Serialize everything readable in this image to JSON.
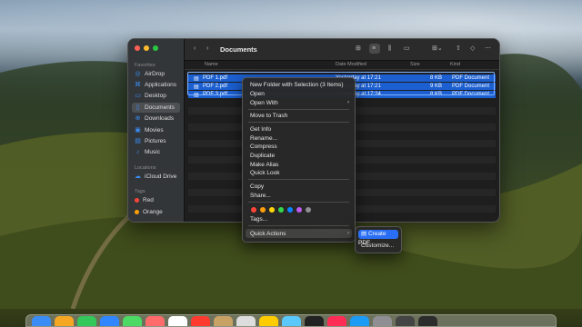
{
  "finder": {
    "title": "Documents",
    "sidebar": {
      "favorites_label": "Favorites",
      "favorites": [
        "AirDrop",
        "Applications",
        "Desktop",
        "Documents",
        "Downloads",
        "Movies",
        "Pictures",
        "Music"
      ],
      "locations_label": "Locations",
      "locations": [
        "iCloud Drive"
      ],
      "tags_label": "Tags",
      "tags": [
        {
          "name": "Red",
          "color": "#ff453a"
        },
        {
          "name": "Orange",
          "color": "#ff9f0a"
        }
      ]
    },
    "columns": {
      "name": "Name",
      "date": "Date Modified",
      "size": "Size",
      "kind": "Kind"
    },
    "files": [
      {
        "name": "PDF 1.pdf",
        "date": "Yesterday at 17:21",
        "size": "8 KB",
        "kind": "PDF Document"
      },
      {
        "name": "PDF 2.pdf",
        "date": "Yesterday at 17:21",
        "size": "9 KB",
        "kind": "PDF Document"
      },
      {
        "name": "PDF 3.pdf",
        "date": "Yesterday at 17:24",
        "size": "8 KB",
        "kind": "PDF Document"
      }
    ]
  },
  "context_menu": {
    "new_folder": "New Folder with Selection (3 Items)",
    "open": "Open",
    "open_with": "Open With",
    "move_to_trash": "Move to Trash",
    "get_info": "Get Info",
    "rename": "Rename...",
    "compress": "Compress",
    "duplicate": "Duplicate",
    "make_alias": "Make Alias",
    "quick_look": "Quick Look",
    "copy": "Copy",
    "share": "Share...",
    "tag_colors": [
      "#ff453a",
      "#ff9f0a",
      "#ffd60a",
      "#32d74b",
      "#0a84ff",
      "#bf5af2",
      "#8e8e93"
    ],
    "tags": "Tags...",
    "quick_actions": "Quick Actions"
  },
  "submenu": {
    "create_pdf": "Create PDF",
    "customize": "Customize..."
  },
  "dock_colors": [
    "#3a8df5",
    "#f5a623",
    "#34c759",
    "#2f86ff",
    "#4cd964",
    "#ff6b6b",
    "#ffffff",
    "#ff3b30",
    "#c8a165",
    "#dddddd",
    "#ffcc00",
    "#5ac8fa",
    "#222222",
    "#ff2d55",
    "#1c9bf5",
    "#8e8e93",
    "#444444",
    "#2c2c2c"
  ]
}
